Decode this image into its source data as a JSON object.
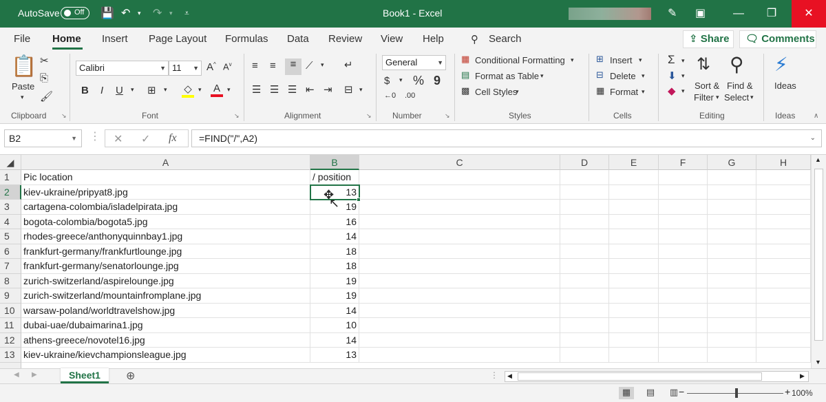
{
  "titlebar": {
    "autosave_label": "AutoSave",
    "autosave_state": "Off",
    "title": "Book1  -  Excel",
    "minimize": "—",
    "restore": "❐",
    "close": "✕"
  },
  "tabs": [
    "File",
    "Home",
    "Insert",
    "Page Layout",
    "Formulas",
    "Data",
    "Review",
    "View",
    "Help"
  ],
  "search_label": "Search",
  "share_label": "Share",
  "comments_label": "Comments",
  "ribbon": {
    "clipboard": {
      "paste": "Paste",
      "label": "Clipboard"
    },
    "font": {
      "name": "Calibri",
      "size": "11",
      "bold": "B",
      "italic": "I",
      "underline": "U",
      "label": "Font"
    },
    "alignment": {
      "label": "Alignment"
    },
    "number": {
      "format": "General",
      "percent": "%",
      "comma": "9",
      "label": "Number"
    },
    "styles": {
      "conditional": "Conditional Formatting",
      "table": "Format as Table",
      "cell_styles": "Cell Styles",
      "label": "Styles"
    },
    "cells": {
      "insert": "Insert",
      "delete": "Delete",
      "format": "Format",
      "label": "Cells"
    },
    "editing": {
      "sort1": "Sort &",
      "sort2": "Filter",
      "find1": "Find &",
      "find2": "Select",
      "label": "Editing"
    },
    "ideas": {
      "button": "Ideas",
      "label": "Ideas"
    }
  },
  "formula_bar": {
    "name_box": "B2",
    "fx": "fx",
    "formula": "=FIND(\"/\",A2)"
  },
  "columns": [
    "A",
    "B",
    "C",
    "D",
    "E",
    "F",
    "G",
    "H"
  ],
  "rows": [
    {
      "n": "1",
      "a": "Pic location",
      "b": "/ position"
    },
    {
      "n": "2",
      "a": "kiev-ukraine/pripyat8.jpg",
      "b": "13"
    },
    {
      "n": "3",
      "a": "cartagena-colombia/isladelpirata.jpg",
      "b": "19"
    },
    {
      "n": "4",
      "a": "bogota-colombia/bogota5.jpg",
      "b": "16"
    },
    {
      "n": "5",
      "a": "rhodes-greece/anthonyquinnbay1.jpg",
      "b": "14"
    },
    {
      "n": "6",
      "a": "frankfurt-germany/frankfurtlounge.jpg",
      "b": "18"
    },
    {
      "n": "7",
      "a": "frankfurt-germany/senatorlounge.jpg",
      "b": "18"
    },
    {
      "n": "8",
      "a": "zurich-switzerland/aspirelounge.jpg",
      "b": "19"
    },
    {
      "n": "9",
      "a": "zurich-switzerland/mountainfromplane.jpg",
      "b": "19"
    },
    {
      "n": "10",
      "a": "warsaw-poland/worldtravelshow.jpg",
      "b": "14"
    },
    {
      "n": "11",
      "a": "dubai-uae/dubaimarina1.jpg",
      "b": "10"
    },
    {
      "n": "12",
      "a": "athens-greece/novotel16.jpg",
      "b": "14"
    },
    {
      "n": "13",
      "a": "kiev-ukraine/kievchampionsleague.jpg",
      "b": "13"
    }
  ],
  "sheet_tab": "Sheet1",
  "zoom": "100%",
  "accent": "#217346"
}
